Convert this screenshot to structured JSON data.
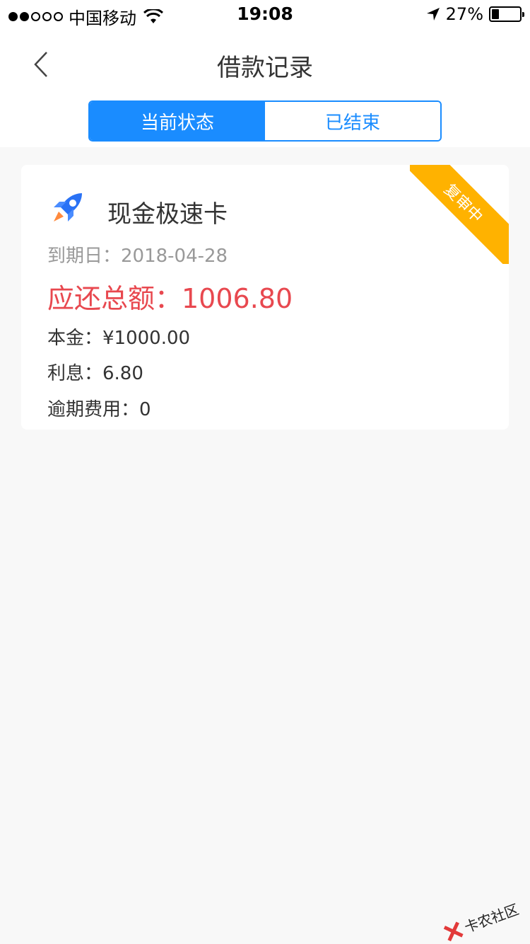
{
  "status_bar": {
    "carrier": "中国移动",
    "time": "19:08",
    "battery": "27%",
    "battery_level": 0.27
  },
  "nav": {
    "title": "借款记录"
  },
  "tabs": [
    {
      "label": "当前状态",
      "active": true
    },
    {
      "label": "已结束",
      "active": false
    }
  ],
  "loan_card": {
    "product_name": "现金极速卡",
    "badge": "复审中",
    "due_date": "到期日：2018-04-28",
    "total_due": "应还总额：1006.80",
    "principal": "本金：¥1000.00",
    "interest": "利息：6.80",
    "overdue_fee": "逾期费用：0"
  },
  "watermark": {
    "text": "卡农社区"
  },
  "colors": {
    "primary": "#1a8cff",
    "badge": "#ffb200",
    "amount": "#e8484f"
  },
  "icons": {
    "back": "chevron-left-icon",
    "product": "rocket-icon"
  }
}
